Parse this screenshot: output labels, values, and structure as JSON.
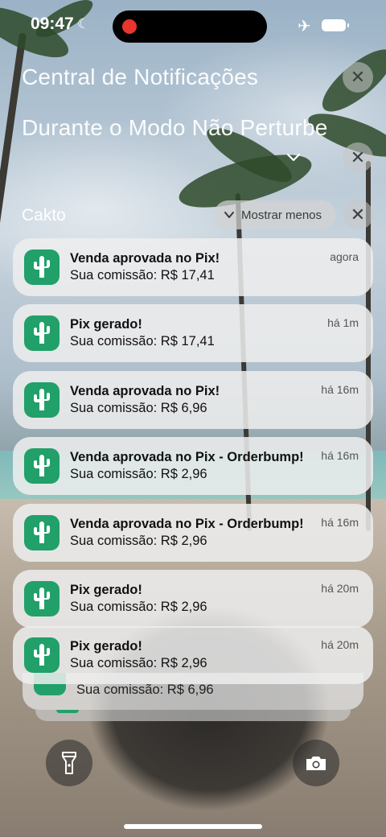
{
  "status_bar": {
    "time": "09:47"
  },
  "header": {
    "title": "Central de Notificações",
    "focus_label": "Durante o Modo Não Perturbe"
  },
  "group": {
    "app_name": "Cakto",
    "collapse_label": "Mostrar menos"
  },
  "notifications": [
    {
      "title": "Venda aprovada no Pix!",
      "body": "Sua comissão: R$ 17,41",
      "time": "agora"
    },
    {
      "title": "Pix gerado!",
      "body": "Sua comissão: R$ 17,41",
      "time": "há 1m"
    },
    {
      "title": "Venda aprovada no Pix!",
      "body": "Sua comissão: R$ 6,96",
      "time": "há 16m"
    },
    {
      "title": "Venda aprovada no Pix - Orderbump!",
      "body": "Sua comissão: R$ 2,96",
      "time": "há 16m"
    },
    {
      "title": "Venda aprovada no Pix - Orderbump!",
      "body": "Sua comissão: R$ 2,96",
      "time": "há 16m"
    },
    {
      "title": "Pix gerado!",
      "body": "Sua comissão: R$ 2,96",
      "time": "há 20m"
    },
    {
      "title": "Pix gerado!",
      "body": "Sua comissão: R$ 2,96",
      "time": "há 20m"
    }
  ],
  "stacked_preview": {
    "body": "Sua comissão: R$ 6,96"
  },
  "icons": {
    "app": "cactus-icon",
    "close": "close-icon",
    "chevron": "chevron-down-icon",
    "flashlight": "flashlight-icon",
    "camera": "camera-icon",
    "airplane": "airplane-icon",
    "battery": "battery-icon",
    "moon": "moon-icon"
  },
  "colors": {
    "app_icon": "#21a06a",
    "recording_dot": "#e8352f"
  }
}
